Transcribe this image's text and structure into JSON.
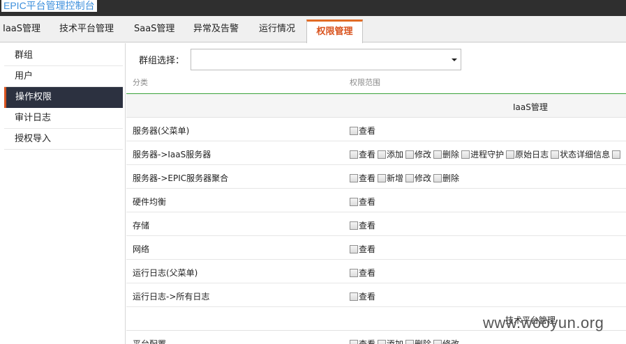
{
  "app": {
    "title": "EPIC平台管理控制台"
  },
  "tabs": [
    {
      "label": "IaaS管理"
    },
    {
      "label": "技术平台管理"
    },
    {
      "label": "SaaS管理"
    },
    {
      "label": "异常及告警"
    },
    {
      "label": "运行情况"
    },
    {
      "label": "权限管理"
    }
  ],
  "sidebar": {
    "items": [
      {
        "label": "群组"
      },
      {
        "label": "用户"
      },
      {
        "label": "操作权限"
      },
      {
        "label": "审计日志"
      },
      {
        "label": "授权导入"
      }
    ]
  },
  "filter": {
    "label": "群组选择：",
    "selected": ""
  },
  "table": {
    "headers": {
      "category": "分类",
      "scope": "权限范围"
    },
    "sections": [
      {
        "title": "IaaS管理",
        "rows": [
          {
            "category": "服务器(父菜单)",
            "perms": [
              "查看"
            ]
          },
          {
            "category": "服务器->IaaS服务器",
            "perms": [
              "查看",
              "添加",
              "修改",
              "删除",
              "进程守护",
              "原始日志",
              "状态详细信息",
              ""
            ]
          },
          {
            "category": "服务器->EPIC服务器聚合",
            "perms": [
              "查看",
              "新增",
              "修改",
              "删除"
            ]
          },
          {
            "category": "硬件均衡",
            "perms": [
              "查看"
            ]
          },
          {
            "category": "存储",
            "perms": [
              "查看"
            ]
          },
          {
            "category": "网络",
            "perms": [
              "查看"
            ]
          },
          {
            "category": "运行日志(父菜单)",
            "perms": [
              "查看"
            ]
          },
          {
            "category": "运行日志->所有日志",
            "perms": [
              "查看"
            ]
          }
        ]
      },
      {
        "title": "技术平台管理",
        "rows": [
          {
            "category": "平台配置",
            "perms": [
              "查看",
              "添加",
              "删除",
              "修改"
            ]
          }
        ]
      }
    ]
  },
  "watermark": "www.wooyun.org",
  "colors": {
    "accent": "#d9531e",
    "sidebar_active_bg": "#2c3140",
    "title_link": "#3c8fdc",
    "header_line": "#3aa33a"
  }
}
